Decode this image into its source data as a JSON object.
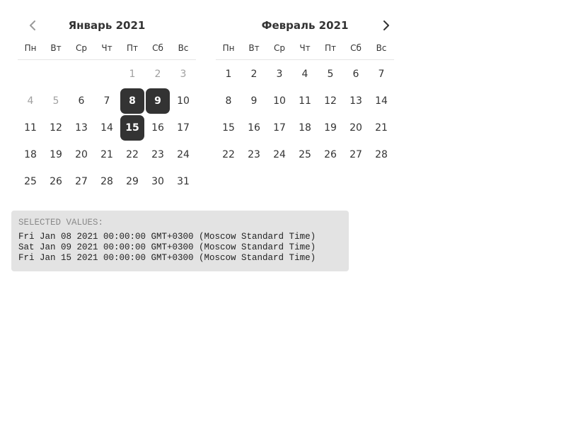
{
  "calendar": {
    "prev_icon": "chevron-left-icon",
    "next_icon": "chevron-right-icon",
    "months": [
      {
        "title": "Январь 2021",
        "weekdays": [
          "Пн",
          "Вт",
          "Ср",
          "Чт",
          "Пт",
          "Сб",
          "Вс"
        ],
        "days": [
          {
            "label": "",
            "state": "empty"
          },
          {
            "label": "",
            "state": "empty"
          },
          {
            "label": "",
            "state": "empty"
          },
          {
            "label": "",
            "state": "empty"
          },
          {
            "label": "1",
            "state": "outside"
          },
          {
            "label": "2",
            "state": "outside"
          },
          {
            "label": "3",
            "state": "outside"
          },
          {
            "label": "4",
            "state": "outside"
          },
          {
            "label": "5",
            "state": "outside"
          },
          {
            "label": "6",
            "state": "normal"
          },
          {
            "label": "7",
            "state": "normal"
          },
          {
            "label": "8",
            "state": "selected"
          },
          {
            "label": "9",
            "state": "selected"
          },
          {
            "label": "10",
            "state": "normal"
          },
          {
            "label": "11",
            "state": "normal"
          },
          {
            "label": "12",
            "state": "normal"
          },
          {
            "label": "13",
            "state": "normal"
          },
          {
            "label": "14",
            "state": "normal"
          },
          {
            "label": "15",
            "state": "selected"
          },
          {
            "label": "16",
            "state": "normal"
          },
          {
            "label": "17",
            "state": "normal"
          },
          {
            "label": "18",
            "state": "normal"
          },
          {
            "label": "19",
            "state": "normal"
          },
          {
            "label": "20",
            "state": "normal"
          },
          {
            "label": "21",
            "state": "normal"
          },
          {
            "label": "22",
            "state": "normal"
          },
          {
            "label": "23",
            "state": "normal"
          },
          {
            "label": "24",
            "state": "normal"
          },
          {
            "label": "25",
            "state": "normal"
          },
          {
            "label": "26",
            "state": "normal"
          },
          {
            "label": "27",
            "state": "normal"
          },
          {
            "label": "28",
            "state": "normal"
          },
          {
            "label": "29",
            "state": "normal"
          },
          {
            "label": "30",
            "state": "normal"
          },
          {
            "label": "31",
            "state": "normal"
          }
        ]
      },
      {
        "title": "Февраль 2021",
        "weekdays": [
          "Пн",
          "Вт",
          "Ср",
          "Чт",
          "Пт",
          "Сб",
          "Вс"
        ],
        "days": [
          {
            "label": "1",
            "state": "normal"
          },
          {
            "label": "2",
            "state": "normal"
          },
          {
            "label": "3",
            "state": "normal"
          },
          {
            "label": "4",
            "state": "normal"
          },
          {
            "label": "5",
            "state": "normal"
          },
          {
            "label": "6",
            "state": "normal"
          },
          {
            "label": "7",
            "state": "normal"
          },
          {
            "label": "8",
            "state": "normal"
          },
          {
            "label": "9",
            "state": "normal"
          },
          {
            "label": "10",
            "state": "normal"
          },
          {
            "label": "11",
            "state": "normal"
          },
          {
            "label": "12",
            "state": "normal"
          },
          {
            "label": "13",
            "state": "normal"
          },
          {
            "label": "14",
            "state": "normal"
          },
          {
            "label": "15",
            "state": "normal"
          },
          {
            "label": "16",
            "state": "normal"
          },
          {
            "label": "17",
            "state": "normal"
          },
          {
            "label": "18",
            "state": "normal"
          },
          {
            "label": "19",
            "state": "normal"
          },
          {
            "label": "20",
            "state": "normal"
          },
          {
            "label": "21",
            "state": "normal"
          },
          {
            "label": "22",
            "state": "normal"
          },
          {
            "label": "23",
            "state": "normal"
          },
          {
            "label": "24",
            "state": "normal"
          },
          {
            "label": "25",
            "state": "normal"
          },
          {
            "label": "26",
            "state": "normal"
          },
          {
            "label": "27",
            "state": "normal"
          },
          {
            "label": "28",
            "state": "normal"
          }
        ]
      }
    ]
  },
  "selected_panel": {
    "title": "SELECTED VALUES:",
    "values": [
      "Fri Jan 08 2021 00:00:00 GMT+0300 (Moscow Standard Time)",
      "Sat Jan 09 2021 00:00:00 GMT+0300 (Moscow Standard Time)",
      "Fri Jan 15 2021 00:00:00 GMT+0300 (Moscow Standard Time)"
    ]
  },
  "colors": {
    "selected_day_bg": "#333333",
    "selected_day_text": "#ffffff",
    "outside_day_text": "#a0a0a0",
    "panel_bg": "#e3e3e3"
  }
}
